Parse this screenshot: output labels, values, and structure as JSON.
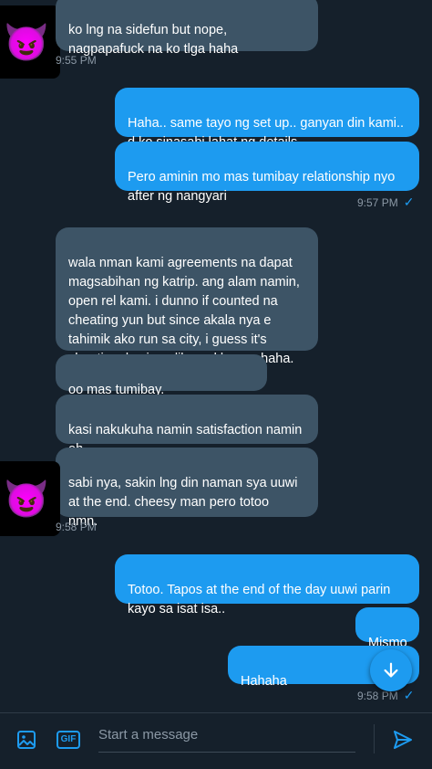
{
  "conversation": {
    "messages": [
      {
        "dir": "in",
        "text": "ko lng na sidefun but nope,\nnagpapafuck na ko tlga haha"
      },
      {
        "dir": "out",
        "text": "Haha.. same tayo ng set up.. ganyan din kami..\nd ko sinasabi lahat ng details.."
      },
      {
        "dir": "out",
        "text": "Pero aminin mo mas tumibay relationship nyo\nafter ng nangyari"
      },
      {
        "dir": "in",
        "text": "wala nman kami agreements na dapat\nmagsabihan ng katrip. ang alam namin,\nopen rel kami. i dunno if counted na\ncheating yun but since akala nya e\ntahimik ako run sa city, i guess it's\ncheating. kasi, malibog akko ron haha."
      },
      {
        "dir": "in",
        "text": "oo mas tumibay."
      },
      {
        "dir": "in",
        "text": "kasi nakukuha namin satisfaction namin\neh"
      },
      {
        "dir": "in",
        "text": "sabi nya, sakin lng din naman sya uuwi\nat the end. cheesy man pero totoo\nnmn."
      },
      {
        "dir": "out",
        "text": "Totoo. Tapos at the end of the day uuwi parin\nkayo sa isat isa.."
      },
      {
        "dir": "out",
        "text": "Mismo"
      },
      {
        "dir": "out",
        "text": "Hahaha"
      }
    ],
    "timestamps": [
      "9:55 PM",
      "9:57 PM",
      "9:58 PM",
      "9:58 PM"
    ],
    "avatar_emoji": "😈"
  },
  "composer": {
    "placeholder": "Start a message",
    "gif_label": "GIF"
  },
  "icons": {
    "image": "image-icon",
    "gif": "gif-icon",
    "send": "send-icon",
    "scroll": "arrow-down-icon",
    "read": "check-icon"
  },
  "colors": {
    "background": "#15202b",
    "incoming": "#3d5466",
    "outgoing": "#1d9bf0",
    "timestamp": "#8b98a5"
  }
}
